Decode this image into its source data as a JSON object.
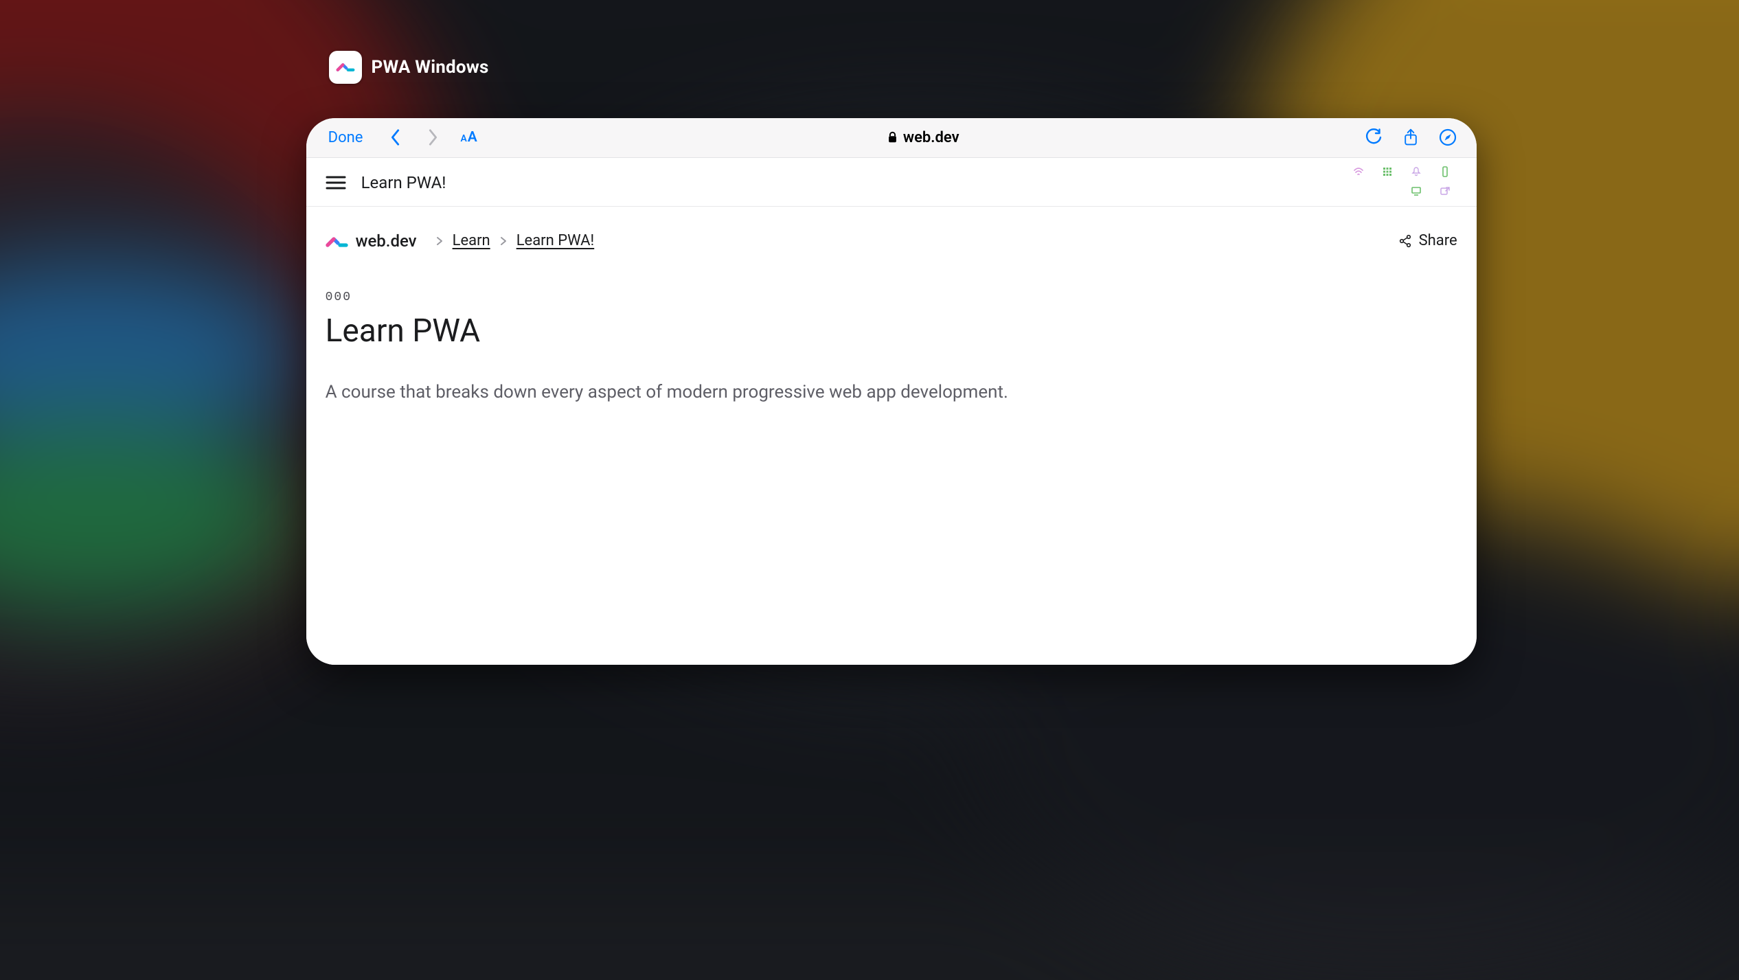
{
  "app": {
    "title": "PWA Windows"
  },
  "safari": {
    "done": "Done",
    "aa_small": "A",
    "aa_big": "A",
    "url_host": "web.dev"
  },
  "page": {
    "header_title": "Learn PWA!",
    "breadcrumb": {
      "site_name": "web.dev",
      "items": [
        "Learn",
        "Learn PWA!"
      ]
    },
    "share_label": "Share",
    "chapter_number": "000",
    "title": "Learn PWA",
    "description": "A course that breaks down every aspect of modern progressive web app development."
  },
  "colors": {
    "ios_blue": "#007aff"
  }
}
